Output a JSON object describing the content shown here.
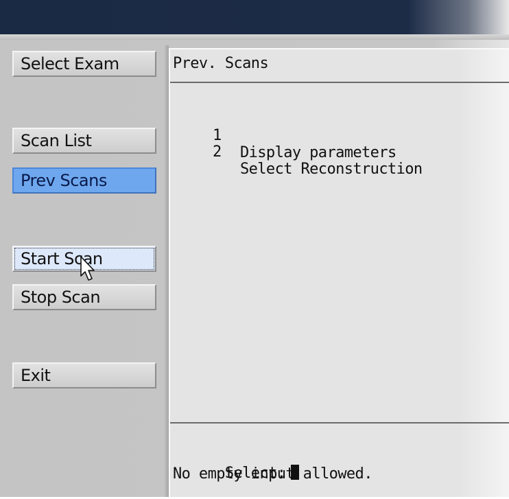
{
  "sidebar": {
    "buttons": {
      "select_exam": "Select Exam",
      "scan_list": "Scan List",
      "prev_scans": "Prev Scans",
      "start_scan": "Start Scan",
      "stop_scan": "Stop Scan",
      "exit": "Exit"
    },
    "active_button": "Prev Scans",
    "focused_button": "Start Scan"
  },
  "main": {
    "title": "Prev. Scans",
    "menu": [
      {
        "number": "1",
        "label": "Display parameters"
      },
      {
        "number": "2",
        "label": "Select Reconstruction"
      }
    ],
    "prompt_label": "Select:",
    "message": "No empty input allowed."
  },
  "icons": {
    "pointer": "arrow-cursor-icon",
    "text_cursor": "block-cursor-icon"
  },
  "colors": {
    "titlebar": "#1b2a44",
    "active_button": "#6ea7ee",
    "panel_background": "#e4e4e4",
    "sidebar_background": "#c4c4c4"
  }
}
